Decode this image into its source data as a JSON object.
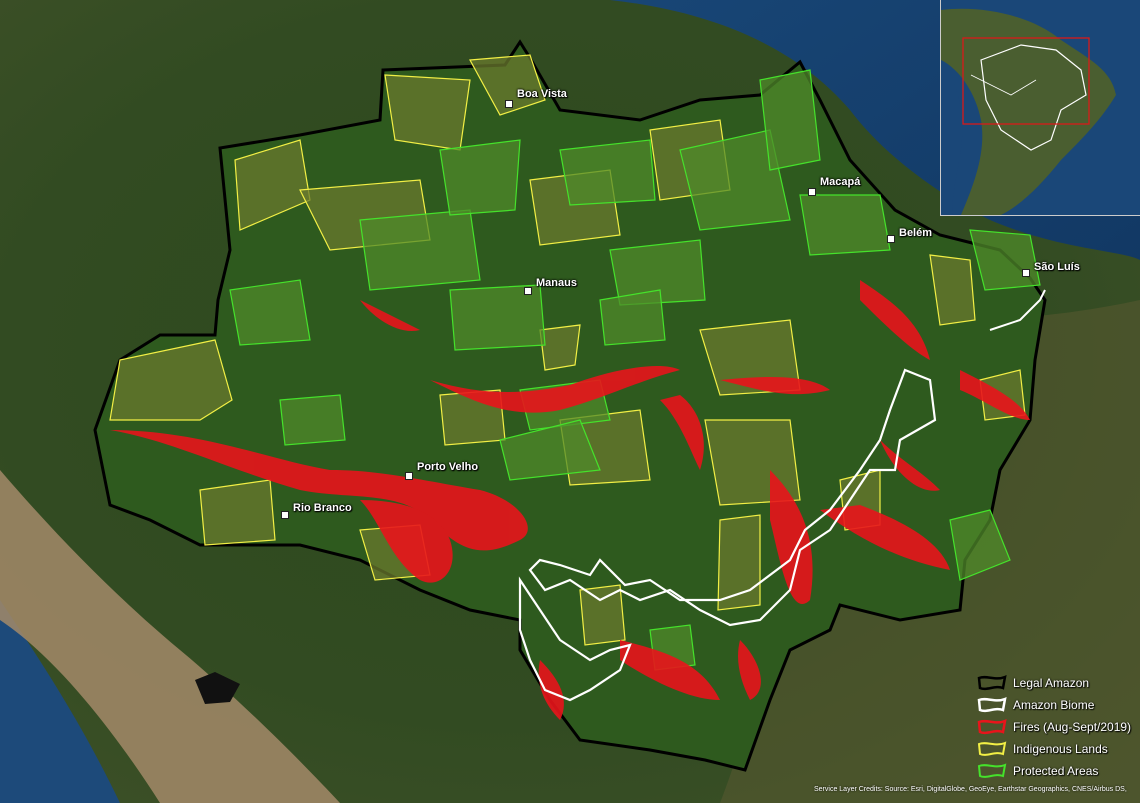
{
  "cities": [
    {
      "name": "Boa Vista"
    },
    {
      "name": "Macapá"
    },
    {
      "name": "Belém"
    },
    {
      "name": "São Luís"
    },
    {
      "name": "Manaus"
    },
    {
      "name": "Porto Velho"
    },
    {
      "name": "Rio Branco"
    }
  ],
  "legend": {
    "items": [
      {
        "label": "Legal Amazon",
        "color": "#000000"
      },
      {
        "label": "Amazon Biome",
        "color": "#ffffff"
      },
      {
        "label": "Fires (Aug-Sept/2019)",
        "color": "#e8141b"
      },
      {
        "label": "Indigenous Lands",
        "color": "#f2ef45"
      },
      {
        "label": "Protected Areas",
        "color": "#45e22b"
      }
    ]
  },
  "inset": {
    "highlight_color": "#d81a1a"
  },
  "credits": "Service Layer Credits: Source: Esri, DigitalGlobe, GeoEye, Earthstar Geographics, CNES/Airbus DS,"
}
